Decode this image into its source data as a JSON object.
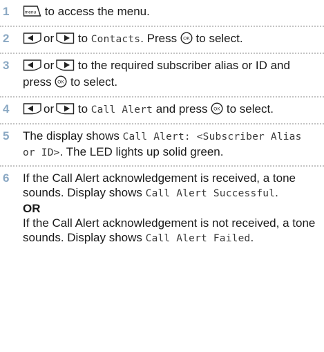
{
  "steps": [
    {
      "number": "1",
      "text_a": " to access the menu.",
      "icon": "menu-key-icon",
      "icon_label": "menu"
    },
    {
      "number": "2",
      "icons": [
        "left-arrow-key-icon",
        "right-arrow-key-icon",
        "ok-key-icon"
      ],
      "text_or": "or",
      "text_to": " to ",
      "mono_1": "Contacts",
      "text_b": ". Press ",
      "text_c": " to select.",
      "ok_label": "OK"
    },
    {
      "number": "3",
      "text_or": "or",
      "text_a": " to the required subscriber alias or ID and press ",
      "text_b": " to select.",
      "ok_label": "OK"
    },
    {
      "number": "4",
      "text_or": "or",
      "text_to": " to ",
      "mono_1": "Call Alert",
      "text_a": " and press ",
      "text_b": " to select.",
      "ok_label": "OK"
    },
    {
      "number": "5",
      "text_a": "The display shows ",
      "mono_1": "Call Alert: <Subscriber Alias or ID>",
      "text_b": ". The LED lights up solid green."
    },
    {
      "number": "6",
      "text_a": "If the Call Alert acknowledgement is received, a tone sounds. Display shows ",
      "mono_1": "Call Alert Successful",
      "text_b": ".",
      "or_label": "OR",
      "text_c": "If the Call Alert acknowledgement is not received, a tone sounds. Display shows ",
      "mono_2": "Call Alert Failed",
      "text_d": "."
    }
  ],
  "colors": {
    "step_number": "#8aa8c3",
    "divider": "#c3c3c3",
    "text": "#1a1a1a"
  }
}
